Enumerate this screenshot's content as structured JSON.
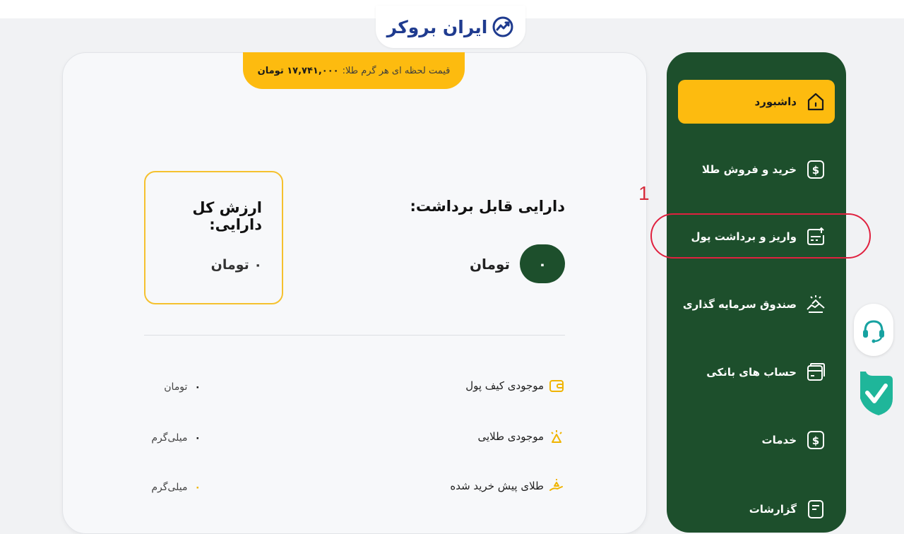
{
  "header": {
    "logo_text": "ایران بروکر"
  },
  "price_banner": {
    "label": "قیمت لحظه ای هر گرم طلا:",
    "value": "۱۷,۷۴۱,۰۰۰ تومان"
  },
  "withdrawable": {
    "title": "دارایی قابل برداشت:",
    "amount": "۰",
    "unit": "تومان"
  },
  "total_value": {
    "title": "ارزش کل دارایی:",
    "value": "۰ تومان"
  },
  "balances": [
    {
      "label": "موجودی کیف پول",
      "icon": "wallet-icon",
      "amount": "۰",
      "unit": "تومان"
    },
    {
      "label": "موجودی طلایی",
      "icon": "gold-bar-icon",
      "amount": "۰",
      "unit": "میلی‌گرم"
    },
    {
      "label": "طلای پیش خرید شده",
      "icon": "hand-gold-icon",
      "amount": "۰",
      "unit": "میلی‌گرم"
    }
  ],
  "sidebar": {
    "items": [
      {
        "label": "داشبورد",
        "icon": "home-icon",
        "active": true
      },
      {
        "label": "خرید و فروش طلا",
        "icon": "dollar-icon"
      },
      {
        "label": "واریز و برداشت پول",
        "icon": "transfer-icon"
      },
      {
        "label": "صندوق سرمایه گذاری",
        "icon": "handshake-icon"
      },
      {
        "label": "حساب های بانکی",
        "icon": "card-icon"
      },
      {
        "label": "خدمات",
        "icon": "dollar-icon"
      },
      {
        "label": "گزارشات",
        "icon": "report-icon"
      }
    ]
  },
  "annotation": {
    "step": "1",
    "color": "#e0213f"
  },
  "colors": {
    "primary_green": "#1d4f2c",
    "accent_yellow": "#fdbb0f",
    "logo_blue": "#1f3b8f"
  }
}
